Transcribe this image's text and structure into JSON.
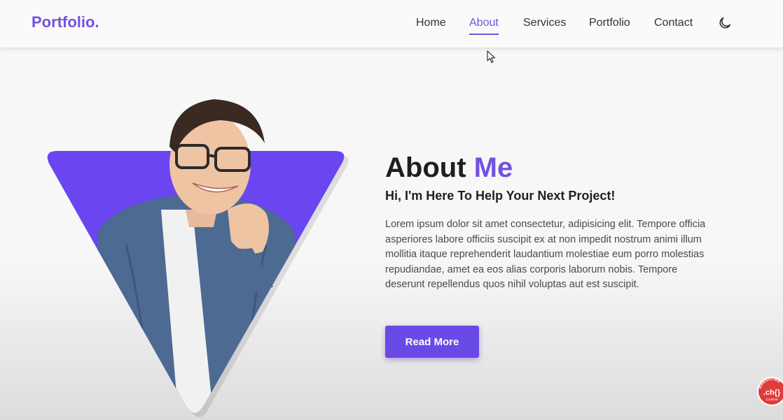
{
  "header": {
    "logo": "Portfolio.",
    "nav": [
      {
        "label": "Home",
        "active": false
      },
      {
        "label": "About",
        "active": true
      },
      {
        "label": "Services",
        "active": false
      },
      {
        "label": "Portfolio",
        "active": false
      },
      {
        "label": "Contact",
        "active": false
      }
    ],
    "theme_toggle_icon": "moon-icon"
  },
  "about": {
    "title_main": "About",
    "title_accent": "Me",
    "subtitle": "Hi, I'm Here To Help Your Next Project!",
    "description": "Lorem ipsum dolor sit amet consectetur, adipisicing elit. Tempore officia asperiores labore officiis suscipit ex at non impedit nostrum animi illum mollitia itaque reprehenderit laudantium molestiae eum porro molestias repudiandae, amet ea eos alias corporis laborum nobis. Tempore deserunt repellendus quos nihil voluptas aut est suscipit.",
    "button_label": "Read More"
  },
  "badge": {
    "ring_text": "Subscribe",
    "inner_text": ".ch{}",
    "small_text": "Codehal"
  },
  "colors": {
    "accent": "#7351e0",
    "button": "#6a4ae6",
    "triangle": "#6a45f0",
    "badge": "#e23b3b"
  }
}
